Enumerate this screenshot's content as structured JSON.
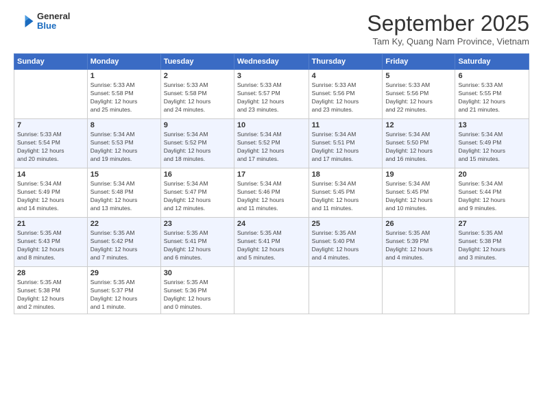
{
  "logo": {
    "general": "General",
    "blue": "Blue"
  },
  "header": {
    "month": "September 2025",
    "location": "Tam Ky, Quang Nam Province, Vietnam"
  },
  "days_of_week": [
    "Sunday",
    "Monday",
    "Tuesday",
    "Wednesday",
    "Thursday",
    "Friday",
    "Saturday"
  ],
  "weeks": [
    {
      "days": [
        {
          "num": "",
          "info": ""
        },
        {
          "num": "1",
          "info": "Sunrise: 5:33 AM\nSunset: 5:58 PM\nDaylight: 12 hours\nand 25 minutes."
        },
        {
          "num": "2",
          "info": "Sunrise: 5:33 AM\nSunset: 5:58 PM\nDaylight: 12 hours\nand 24 minutes."
        },
        {
          "num": "3",
          "info": "Sunrise: 5:33 AM\nSunset: 5:57 PM\nDaylight: 12 hours\nand 23 minutes."
        },
        {
          "num": "4",
          "info": "Sunrise: 5:33 AM\nSunset: 5:56 PM\nDaylight: 12 hours\nand 23 minutes."
        },
        {
          "num": "5",
          "info": "Sunrise: 5:33 AM\nSunset: 5:56 PM\nDaylight: 12 hours\nand 22 minutes."
        },
        {
          "num": "6",
          "info": "Sunrise: 5:33 AM\nSunset: 5:55 PM\nDaylight: 12 hours\nand 21 minutes."
        }
      ]
    },
    {
      "days": [
        {
          "num": "7",
          "info": "Sunrise: 5:33 AM\nSunset: 5:54 PM\nDaylight: 12 hours\nand 20 minutes."
        },
        {
          "num": "8",
          "info": "Sunrise: 5:34 AM\nSunset: 5:53 PM\nDaylight: 12 hours\nand 19 minutes."
        },
        {
          "num": "9",
          "info": "Sunrise: 5:34 AM\nSunset: 5:52 PM\nDaylight: 12 hours\nand 18 minutes."
        },
        {
          "num": "10",
          "info": "Sunrise: 5:34 AM\nSunset: 5:52 PM\nDaylight: 12 hours\nand 17 minutes."
        },
        {
          "num": "11",
          "info": "Sunrise: 5:34 AM\nSunset: 5:51 PM\nDaylight: 12 hours\nand 17 minutes."
        },
        {
          "num": "12",
          "info": "Sunrise: 5:34 AM\nSunset: 5:50 PM\nDaylight: 12 hours\nand 16 minutes."
        },
        {
          "num": "13",
          "info": "Sunrise: 5:34 AM\nSunset: 5:49 PM\nDaylight: 12 hours\nand 15 minutes."
        }
      ]
    },
    {
      "days": [
        {
          "num": "14",
          "info": "Sunrise: 5:34 AM\nSunset: 5:49 PM\nDaylight: 12 hours\nand 14 minutes."
        },
        {
          "num": "15",
          "info": "Sunrise: 5:34 AM\nSunset: 5:48 PM\nDaylight: 12 hours\nand 13 minutes."
        },
        {
          "num": "16",
          "info": "Sunrise: 5:34 AM\nSunset: 5:47 PM\nDaylight: 12 hours\nand 12 minutes."
        },
        {
          "num": "17",
          "info": "Sunrise: 5:34 AM\nSunset: 5:46 PM\nDaylight: 12 hours\nand 11 minutes."
        },
        {
          "num": "18",
          "info": "Sunrise: 5:34 AM\nSunset: 5:45 PM\nDaylight: 12 hours\nand 11 minutes."
        },
        {
          "num": "19",
          "info": "Sunrise: 5:34 AM\nSunset: 5:45 PM\nDaylight: 12 hours\nand 10 minutes."
        },
        {
          "num": "20",
          "info": "Sunrise: 5:34 AM\nSunset: 5:44 PM\nDaylight: 12 hours\nand 9 minutes."
        }
      ]
    },
    {
      "days": [
        {
          "num": "21",
          "info": "Sunrise: 5:35 AM\nSunset: 5:43 PM\nDaylight: 12 hours\nand 8 minutes."
        },
        {
          "num": "22",
          "info": "Sunrise: 5:35 AM\nSunset: 5:42 PM\nDaylight: 12 hours\nand 7 minutes."
        },
        {
          "num": "23",
          "info": "Sunrise: 5:35 AM\nSunset: 5:41 PM\nDaylight: 12 hours\nand 6 minutes."
        },
        {
          "num": "24",
          "info": "Sunrise: 5:35 AM\nSunset: 5:41 PM\nDaylight: 12 hours\nand 5 minutes."
        },
        {
          "num": "25",
          "info": "Sunrise: 5:35 AM\nSunset: 5:40 PM\nDaylight: 12 hours\nand 4 minutes."
        },
        {
          "num": "26",
          "info": "Sunrise: 5:35 AM\nSunset: 5:39 PM\nDaylight: 12 hours\nand 4 minutes."
        },
        {
          "num": "27",
          "info": "Sunrise: 5:35 AM\nSunset: 5:38 PM\nDaylight: 12 hours\nand 3 minutes."
        }
      ]
    },
    {
      "days": [
        {
          "num": "28",
          "info": "Sunrise: 5:35 AM\nSunset: 5:38 PM\nDaylight: 12 hours\nand 2 minutes."
        },
        {
          "num": "29",
          "info": "Sunrise: 5:35 AM\nSunset: 5:37 PM\nDaylight: 12 hours\nand 1 minute."
        },
        {
          "num": "30",
          "info": "Sunrise: 5:35 AM\nSunset: 5:36 PM\nDaylight: 12 hours\nand 0 minutes."
        },
        {
          "num": "",
          "info": ""
        },
        {
          "num": "",
          "info": ""
        },
        {
          "num": "",
          "info": ""
        },
        {
          "num": "",
          "info": ""
        }
      ]
    }
  ]
}
